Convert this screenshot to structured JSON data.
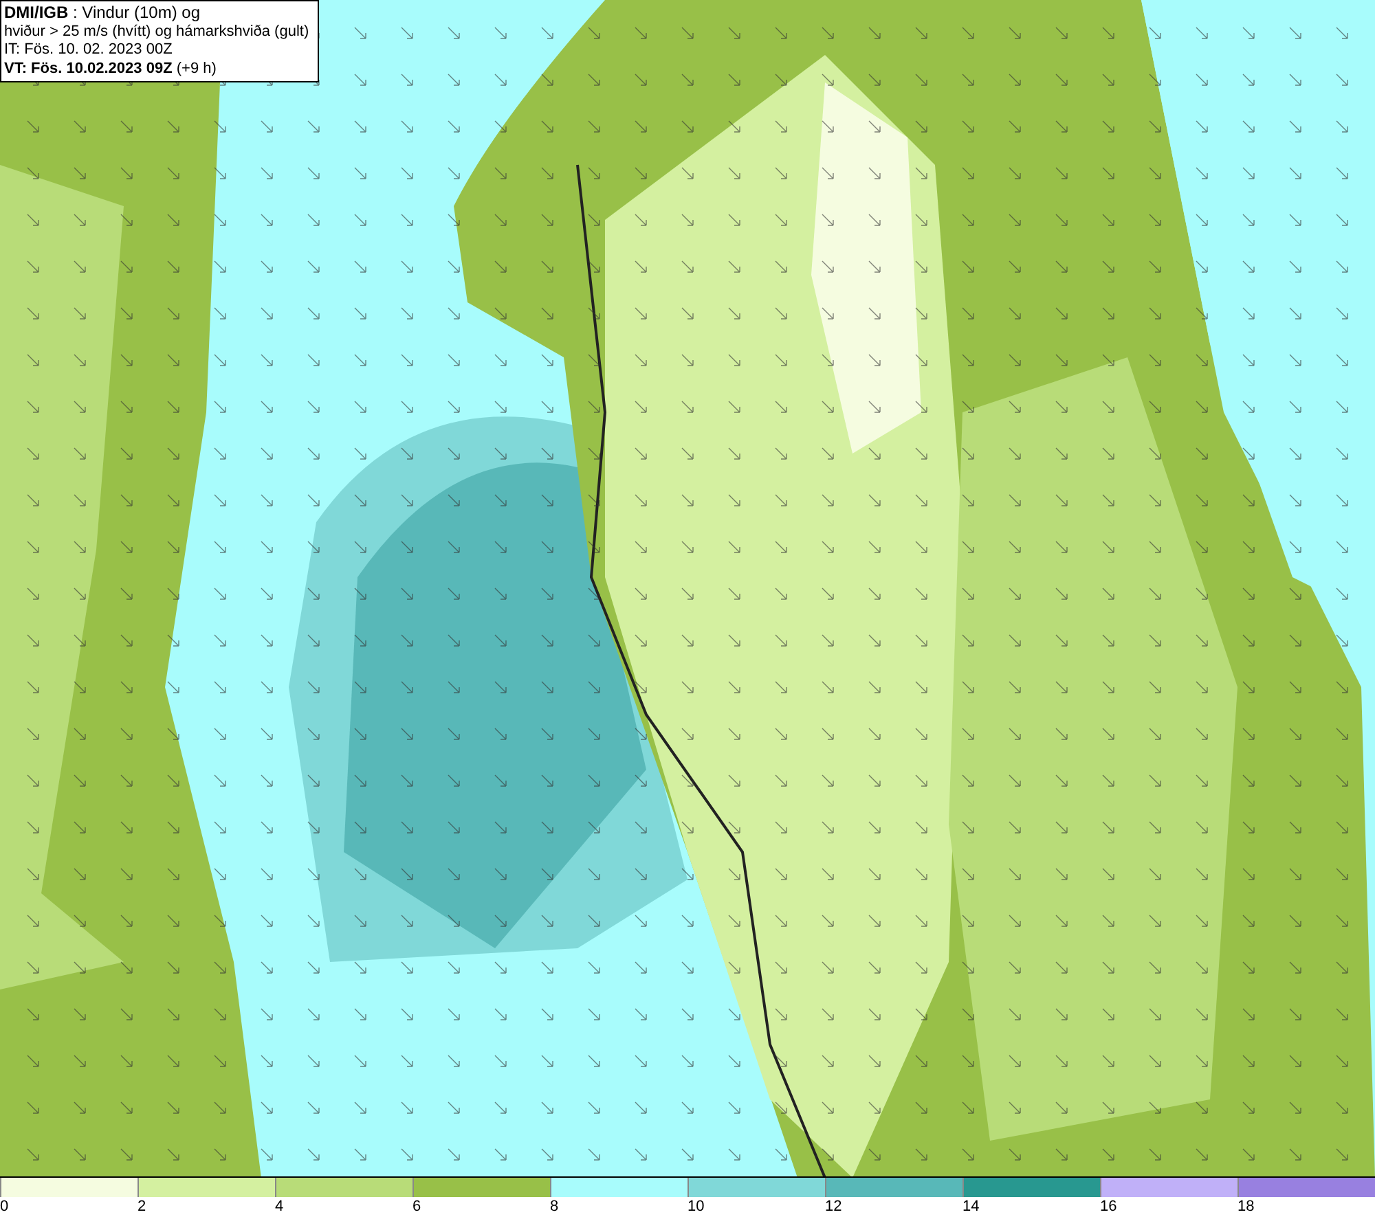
{
  "info": {
    "lines": [
      "**DMI/IGB** : Vindur (10m) og",
      "hviður > 25 m/s (hvítt) og hámarkshviða (gult)",
      "IT: Fös. 10. 02. 2023 00Z",
      "**VT: Fös. 10.02.2023 09Z** (+9 h)"
    ]
  },
  "legend": [
    {
      "label": "0",
      "color": "#f5fce0"
    },
    {
      "label": "2",
      "color": "#d4f0a0"
    },
    {
      "label": "4",
      "color": "#b8dc78"
    },
    {
      "label": "6",
      "color": "#98c048"
    },
    {
      "label": "8",
      "color": "#a8fcfc"
    },
    {
      "label": "10",
      "color": "#80d8d8"
    },
    {
      "label": "12",
      "color": "#58b8b8"
    },
    {
      "label": "14",
      "color": "#289890"
    },
    {
      "label": "16",
      "color": "#c0b0f8"
    },
    {
      "label": "18",
      "color": "#9880e0"
    }
  ]
}
